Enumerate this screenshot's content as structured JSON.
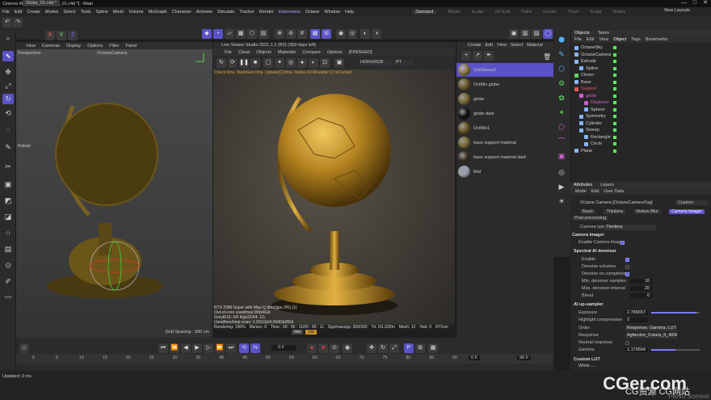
{
  "window": {
    "title": "Cinema 4D R25.117 - [Globe_01.c4d *] - Main",
    "doc_tab": "Globe_01.c4d *",
    "controls": [
      "—",
      "□",
      "✕"
    ]
  },
  "menubar": {
    "items": [
      "File",
      "Edit",
      "Create",
      "Modes",
      "Select",
      "Tools",
      "Spline",
      "Mesh",
      "Volume",
      "MoGraph",
      "Character",
      "Animate",
      "Simulate",
      "Tracker",
      "Render",
      "Extensions",
      "Octane",
      "Window",
      "Help"
    ],
    "highlight_color": "#a6a6ff"
  },
  "layouts": {
    "items": [
      "Standard",
      "Model",
      "Sculpt",
      "UV Edit",
      "Paint",
      "Groom",
      "Track",
      "Script",
      "Nodes"
    ],
    "active": "Standard",
    "new_layouts": "New Layouts"
  },
  "toolbar": {
    "axes": [
      "X",
      "Y",
      "Z"
    ]
  },
  "viewport": {
    "menu": [
      "View",
      "Cameras",
      "Display",
      "Options",
      "Filter",
      "Panel"
    ],
    "name": "Perspective",
    "camera": "OctaneCamera",
    "rotate_label": "Rotate",
    "grid": "Grid Spacing : 500 cm"
  },
  "live_viewer": {
    "title": "Live Viewer Studio 2021.1.1 (R2) (369 days left)",
    "menu": [
      "File",
      "Cloud",
      "Objects",
      "Materials",
      "Compare",
      "Options",
      "[FINISHED]"
    ],
    "colorspace": "HDR/sRGB",
    "mode": "PT",
    "check_line": "Check:0ms. MeshGen:0ms. Update[C]:0ms. Nodes:43 Movable:12 txCached",
    "status_lines": [
      "RTX 2080 Super with Max-Q 8ms(gpu 3%) (1)",
      "Out-of-core used/max:0Kb/4Gb",
      "Grey8/16: 0/0        Rgb32/64: 1/1",
      "Used/free/total vram: 2.031Gb/4.069Gb/8Gb"
    ],
    "render_bar": {
      "rendering": "Rendering: 100%",
      "ms": "Ms/sec: 0",
      "time": "Time : 00 : 00 : 11/00 : 00 : 11",
      "spp": "Spp/maxspp: 300/300",
      "tri": "Tri: 0/1.029m",
      "mesh": "Mesh: 12",
      "hair": "Hair: 0",
      "rtx": "RTXon"
    },
    "bottom_tabs": [
      "Mat",
      "Sid"
    ]
  },
  "materials": {
    "menu": [
      "Create",
      "Edit",
      "View",
      "Select",
      "Material"
    ],
    "items": [
      {
        "name": "OctGlossy1",
        "color": "#8a7a3a",
        "selected": true
      },
      {
        "name": "OctMix globe",
        "color": "#6b5a2a",
        "selected": false
      },
      {
        "name": "globe",
        "color": "#7a6a34",
        "selected": false
      },
      {
        "name": "globe dark",
        "color": "#111111",
        "selected": false
      },
      {
        "name": "OctMix1",
        "color": "#6b5a2a",
        "selected": false
      },
      {
        "name": "base support material",
        "color": "#7a6a34",
        "selected": false
      },
      {
        "name": "base support material dark",
        "color": "#3a3020",
        "selected": false
      },
      {
        "name": "Mat",
        "color": "#9aa0b0",
        "selected": false
      }
    ]
  },
  "objects": {
    "tabs": [
      "Objects",
      "Takes"
    ],
    "menu": [
      "File",
      "Edit",
      "View",
      "Object",
      "Tags",
      "Bookmarks"
    ],
    "items": [
      {
        "name": "OctaneSky",
        "indent": 0,
        "color": "#8ab4ff"
      },
      {
        "name": "OctaneCamera",
        "indent": 0,
        "color": "#8ab4ff"
      },
      {
        "name": "Extrude",
        "indent": 0,
        "color": "#8ab4ff"
      },
      {
        "name": "Spline",
        "indent": 1,
        "color": "#8ab4ff"
      },
      {
        "name": "Cloner",
        "indent": 0,
        "color": "#5fd35f"
      },
      {
        "name": "Base",
        "indent": 0,
        "color": "#8ab4ff"
      },
      {
        "name": "Support",
        "indent": 0,
        "color": "#e05a5a"
      },
      {
        "name": "globe",
        "indent": 1,
        "color": "#d060d0"
      },
      {
        "name": "Displacer",
        "indent": 2,
        "color": "#d060d0"
      },
      {
        "name": "Sphere",
        "indent": 2,
        "color": "#8ab4ff"
      },
      {
        "name": "Symmetry",
        "indent": 1,
        "color": "#8ab4ff"
      },
      {
        "name": "Cylinder",
        "indent": 1,
        "color": "#8ab4ff"
      },
      {
        "name": "Sweep",
        "indent": 1,
        "color": "#8ab4ff"
      },
      {
        "name": "Rectangle",
        "indent": 2,
        "color": "#8ab4ff"
      },
      {
        "name": "Circle",
        "indent": 2,
        "color": "#8ab4ff"
      },
      {
        "name": "Plane",
        "indent": 0,
        "color": "#8ab4ff"
      }
    ]
  },
  "attributes": {
    "tabs": [
      "Attributes",
      "Layers"
    ],
    "menu": [
      "Mode",
      "Edit",
      "User Data"
    ],
    "header": "Octane Camera [OctaneCameraTag]",
    "preset": "Custom",
    "subtabs": [
      "Basic",
      "Thinlens",
      "Motion Blur",
      "Camera Imager"
    ],
    "active_subtab": "Camera Imager",
    "post_tab": "Post processing",
    "camera_type_label": "Camera type",
    "camera_type": "Thinlens",
    "section_imager": "Camera Imager",
    "enable_imager": "Enable Camera Imager",
    "section_denoiser": "Spectral AI denoiser",
    "enable": "Enable",
    "denoise_volumes": "Denoise volumes",
    "denoise_on_completion": "Denoise on completion",
    "min_samples_label": "Min. denoiser samples",
    "min_samples": "10",
    "max_interval_label": "Max. denoiser interval",
    "max_interval": "20",
    "blend_label": "Blend",
    "blend": "0",
    "section_upsampler": "AI up-sampler",
    "exposure_label": "Exposure",
    "exposure": "2.786657",
    "exposure_frac": 0.93,
    "highlight_label": "Highlight compression",
    "highlight": "0",
    "order_label": "Order",
    "order": "Response, Gamma, LUT",
    "response_label": "Response",
    "response": "Agfacolor_Futura_II_400CD",
    "neutral_label": "Neutral response",
    "gamma_label": "Gamma",
    "gamma": "1.170504",
    "gamma_frac": 0.5,
    "custom_lut": "Custom LUT",
    "white_label": "White ..."
  },
  "timeline": {
    "frame_start": "0 F",
    "frame_end": "90 F",
    "current": "0 F",
    "ticks": [
      "0",
      "5",
      "10",
      "15",
      "20",
      "25",
      "30",
      "35",
      "40",
      "45",
      "50",
      "55",
      "60",
      "65",
      "70",
      "75",
      "80",
      "85",
      "90"
    ],
    "range_start": "0 F",
    "range_end": "90 F"
  },
  "status_bar": "Updated: 0 ms.",
  "watermark": {
    "logo": "CGer.com",
    "sub": "CG资源 CG网站",
    "corner": "Pantu Someet"
  }
}
